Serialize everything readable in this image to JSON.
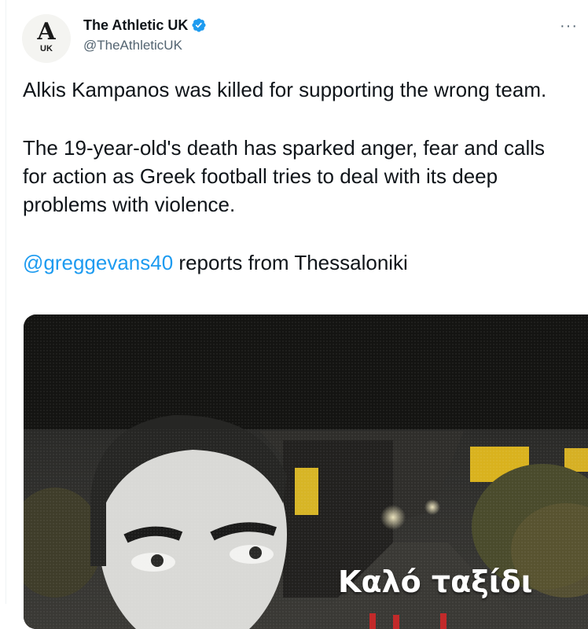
{
  "account": {
    "display_name": "The Athletic UK",
    "handle": "@TheAthleticUK",
    "avatar_letter": "A",
    "avatar_sub": "UK",
    "verified_color": "#1d9bf0"
  },
  "menu": {
    "more_label": "···"
  },
  "tweet": {
    "paragraph1": "Alkis Kampanos was killed for supporting the wrong team.",
    "paragraph2": "The 19-year-old's death has sparked anger, fear and calls for action as Greek football tries to deal with its deep problems with violence.",
    "mention": "@greggevans40",
    "paragraph3_rest": " reports from Thessaloniki",
    "mention_color": "#1d9bf0"
  },
  "media": {
    "caption": "Καλό ταξίδι"
  }
}
